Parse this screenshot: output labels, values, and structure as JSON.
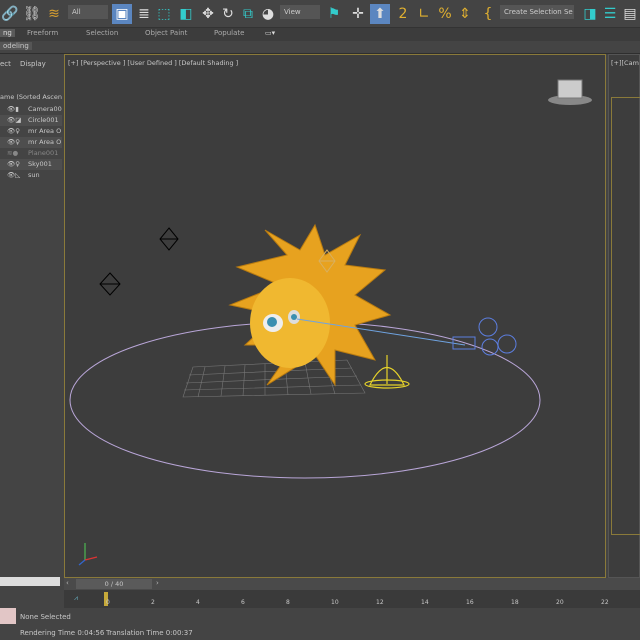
{
  "toolbar": {
    "filter": "All",
    "refcoord": "View",
    "selset": "Create Selection Se"
  },
  "ribbon": {
    "tabs": [
      "ng",
      "Freeform",
      "Selection",
      "Object Paint",
      "Populate"
    ],
    "sub": "odeling"
  },
  "scene": {
    "tabs": [
      "ect",
      "Display"
    ],
    "header": "ame (Sorted Ascen",
    "items": [
      "Camera00",
      "Circle001",
      "mr Area O",
      "mr Area O",
      "Plane001",
      "Sky001",
      "sun"
    ]
  },
  "viewport": {
    "label": "[+] [Perspective ] [User Defined ] [Default Shading ]",
    "label2": "[+][Cam"
  },
  "timeline": {
    "frame": "0 / 40",
    "ticks": [
      "0",
      "2",
      "4",
      "6",
      "8",
      "10",
      "12",
      "14",
      "16",
      "18",
      "20",
      "22"
    ]
  },
  "status": {
    "selection": "None Selected",
    "render": "Rendering Time  0:04:56",
    "translation": "Translation Time  0:00:37"
  }
}
